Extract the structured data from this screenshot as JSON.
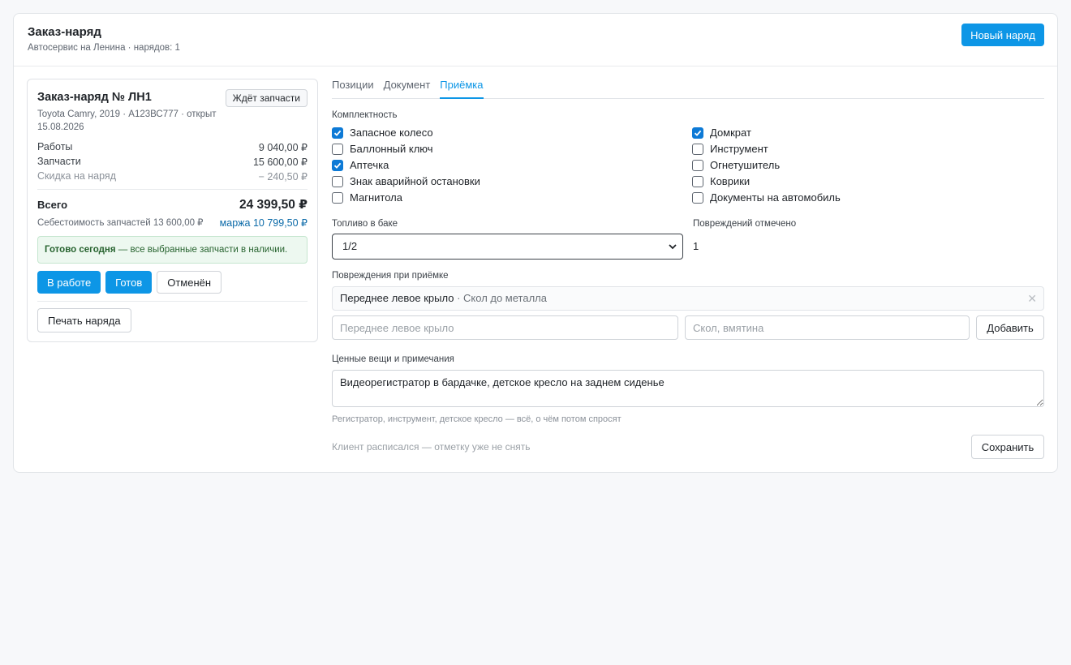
{
  "header": {
    "title": "Заказ-наряд",
    "subtitle": "Автосервис на Ленина · нарядов: 1",
    "new_order_label": "Новый наряд"
  },
  "summary": {
    "title": "Заказ-наряд № ЛН1",
    "badge": "Ждёт запчасти",
    "meta": "Toyota Camry, 2019 · А123ВС777 · открыт 15.08.2026",
    "rows": [
      {
        "label": "Работы",
        "value": "9 040,00 ₽"
      },
      {
        "label": "Запчасти",
        "value": "15 600,00 ₽"
      },
      {
        "label": "Скидка на наряд",
        "value": "− 240,50 ₽"
      }
    ],
    "total_label": "Всего",
    "total_value": "24 399,50 ₽",
    "parts_cost": "Себестоимость запчастей 13 600,00 ₽",
    "margin": "маржа 10 799,50 ₽",
    "notice_bold": "Готово сегодня",
    "notice_text": " — все выбранные запчасти в наличии.",
    "status_buttons": [
      {
        "label": "В работе",
        "active": true
      },
      {
        "label": "Готов",
        "active": true
      },
      {
        "label": "Отменён",
        "active": false
      }
    ],
    "print_label": "Печать наряда"
  },
  "tabs": [
    {
      "label": "Позиции",
      "active": false
    },
    {
      "label": "Документ",
      "active": false
    },
    {
      "label": "Приёмка",
      "active": true
    }
  ],
  "intake": {
    "completeness_label": "Комплектность",
    "items_left": [
      {
        "label": "Запасное колесо",
        "checked": true
      },
      {
        "label": "Баллонный ключ",
        "checked": false
      },
      {
        "label": "Аптечка",
        "checked": true
      },
      {
        "label": "Знак аварийной остановки",
        "checked": false
      },
      {
        "label": "Магнитола",
        "checked": false
      }
    ],
    "items_right": [
      {
        "label": "Домкрат",
        "checked": true
      },
      {
        "label": "Инструмент",
        "checked": false
      },
      {
        "label": "Огнетушитель",
        "checked": false
      },
      {
        "label": "Коврики",
        "checked": false
      },
      {
        "label": "Документы на автомобиль",
        "checked": false
      }
    ],
    "fuel_label": "Топливо в баке",
    "fuel_value": "1/2",
    "damage_count_label": "Повреждений отмечено",
    "damage_count": "1",
    "damages_label": "Повреждения при приёмке",
    "damage_item_part": "Переднее левое крыло",
    "damage_item_desc": " · Скол до металла",
    "part_placeholder": "Переднее левое крыло",
    "desc_placeholder": "Скол, вмятина",
    "add_label": "Добавить",
    "notes_label": "Ценные вещи и примечания",
    "notes_value": "Видеорегистратор в бардачке, детское кресло на заднем сиденье",
    "notes_hint": "Регистратор, инструмент, детское кресло — всё, о чём потом спросят",
    "signed_hint": "Клиент расписался — отметку уже не снять",
    "save_label": "Сохранить"
  },
  "colors": {
    "accent": "#0d96e6",
    "checkbox": "#0d7ad6",
    "notice_bg": "#edf8f0",
    "margin_text": "#0b6aa8"
  }
}
